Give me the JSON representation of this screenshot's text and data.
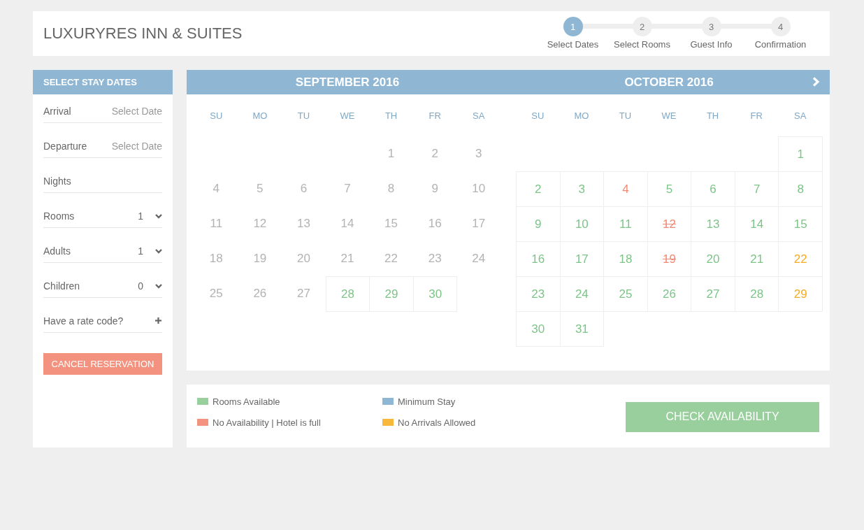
{
  "header": {
    "title": "LUXURYRES INN & SUITES",
    "steps": [
      {
        "number": "1",
        "label": "Select Dates",
        "selected": true
      },
      {
        "number": "2",
        "label": "Select Rooms",
        "selected": false
      },
      {
        "number": "3",
        "label": "Guest Info",
        "selected": false
      },
      {
        "number": "4",
        "label": "Confirmation",
        "selected": false
      }
    ]
  },
  "sidebar": {
    "title": "SELECT STAY DATES",
    "fields": [
      {
        "kind": "date",
        "label": "Arrival",
        "placeholder": "Select Date"
      },
      {
        "kind": "date",
        "label": "Departure",
        "placeholder": "Select Date"
      },
      {
        "kind": "plain",
        "label": "Nights"
      },
      {
        "kind": "select",
        "label": "Rooms",
        "value": "1"
      },
      {
        "kind": "select",
        "label": "Adults",
        "value": "1"
      },
      {
        "kind": "select",
        "label": "Children",
        "value": "0"
      },
      {
        "kind": "toggle",
        "label": "Have a rate code?",
        "expanded": false
      }
    ],
    "cancel_button": "CANCEL RESERVATION"
  },
  "calendar": {
    "next_button": true,
    "months": [
      {
        "title": "SEPTEMBER 2016",
        "weekdays": [
          "SU",
          "MO",
          "TU",
          "WE",
          "TH",
          "FR",
          "SA"
        ],
        "weeks": [
          [
            {
              "day": "1",
              "kind": "past"
            },
            {
              "day": "2",
              "kind": "past"
            },
            {
              "day": "3",
              "kind": "past"
            }
          ],
          [
            {
              "day": "4",
              "kind": "past"
            },
            {
              "day": "5",
              "kind": "past"
            },
            {
              "day": "6",
              "kind": "past"
            },
            {
              "day": "7",
              "kind": "past"
            },
            {
              "day": "8",
              "kind": "past"
            },
            {
              "day": "9",
              "kind": "past"
            },
            {
              "day": "10",
              "kind": "past"
            }
          ],
          [
            {
              "day": "11",
              "kind": "past"
            },
            {
              "day": "12",
              "kind": "past"
            },
            {
              "day": "13",
              "kind": "past"
            },
            {
              "day": "14",
              "kind": "past"
            },
            {
              "day": "15",
              "kind": "past"
            },
            {
              "day": "16",
              "kind": "past"
            },
            {
              "day": "17",
              "kind": "past"
            }
          ],
          [
            {
              "day": "18",
              "kind": "past"
            },
            {
              "day": "19",
              "kind": "past"
            },
            {
              "day": "20",
              "kind": "past"
            },
            {
              "day": "21",
              "kind": "past"
            },
            {
              "day": "22",
              "kind": "past"
            },
            {
              "day": "23",
              "kind": "past"
            },
            {
              "day": "24",
              "kind": "past"
            }
          ],
          [
            {
              "day": "25",
              "kind": "past"
            },
            {
              "day": "26",
              "kind": "past"
            },
            {
              "day": "27",
              "kind": "past"
            },
            {
              "day": "28",
              "kind": "available"
            },
            {
              "day": "29",
              "kind": "available"
            },
            {
              "day": "30",
              "kind": "available"
            }
          ]
        ]
      },
      {
        "title": "OCTOBER 2016",
        "weekdays": [
          "SU",
          "MO",
          "TU",
          "WE",
          "TH",
          "FR",
          "SA"
        ],
        "weeks": [
          [
            {
              "day": "1",
              "kind": "available"
            }
          ],
          [
            {
              "day": "2",
              "kind": "available"
            },
            {
              "day": "3",
              "kind": "available"
            },
            {
              "day": "4",
              "kind": "full"
            },
            {
              "day": "5",
              "kind": "available"
            },
            {
              "day": "6",
              "kind": "available"
            },
            {
              "day": "7",
              "kind": "available"
            },
            {
              "day": "8",
              "kind": "available"
            }
          ],
          [
            {
              "day": "9",
              "kind": "available"
            },
            {
              "day": "10",
              "kind": "available"
            },
            {
              "day": "11",
              "kind": "available"
            },
            {
              "day": "12",
              "kind": "closed"
            },
            {
              "day": "13",
              "kind": "available"
            },
            {
              "day": "14",
              "kind": "available"
            },
            {
              "day": "15",
              "kind": "available"
            }
          ],
          [
            {
              "day": "16",
              "kind": "available"
            },
            {
              "day": "17",
              "kind": "available"
            },
            {
              "day": "18",
              "kind": "available"
            },
            {
              "day": "19",
              "kind": "closed"
            },
            {
              "day": "20",
              "kind": "available"
            },
            {
              "day": "21",
              "kind": "available"
            },
            {
              "day": "22",
              "kind": "restricted"
            }
          ],
          [
            {
              "day": "23",
              "kind": "available"
            },
            {
              "day": "24",
              "kind": "available"
            },
            {
              "day": "25",
              "kind": "available"
            },
            {
              "day": "26",
              "kind": "available"
            },
            {
              "day": "27",
              "kind": "available"
            },
            {
              "day": "28",
              "kind": "available"
            },
            {
              "day": "29",
              "kind": "restricted"
            }
          ],
          [
            {
              "day": "30",
              "kind": "available"
            },
            {
              "day": "31",
              "kind": "available"
            }
          ]
        ]
      }
    ]
  },
  "legend": {
    "items": [
      {
        "label": "Rooms Available",
        "color": "#98cf9c"
      },
      {
        "label": "Minimum Stay",
        "color": "#8fb6d3"
      },
      {
        "label": "No Availability | Hotel is full",
        "color": "#f3937f"
      },
      {
        "label": "No Arrivals Allowed",
        "color": "#f8b93a"
      }
    ],
    "check_button": "CHECK AVAILABILITY"
  }
}
